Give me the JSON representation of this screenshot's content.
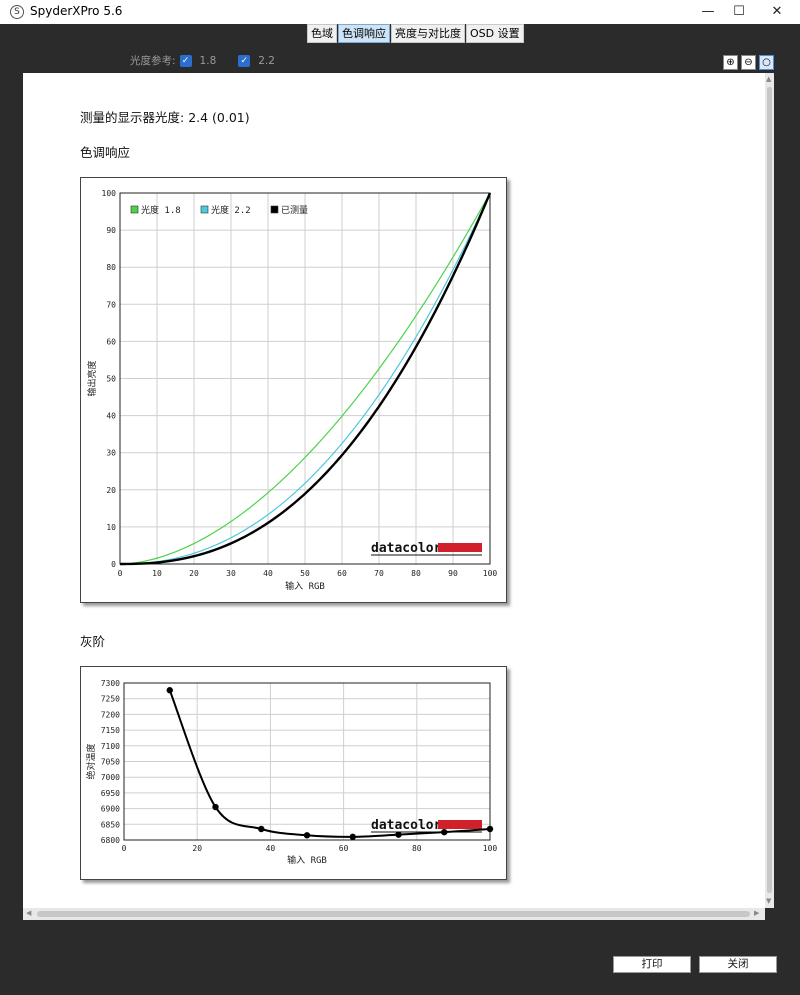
{
  "window": {
    "title": "SpyderXPro 5.6",
    "app_icon_glyph": "S",
    "controls": [
      "—",
      "☐",
      "✕"
    ]
  },
  "tabs": [
    {
      "label": "色域",
      "active": false
    },
    {
      "label": "色调响应",
      "active": true
    },
    {
      "label": "亮度与对比度",
      "active": false
    },
    {
      "label": "OSD 设置",
      "active": false
    }
  ],
  "reference": {
    "label": "光度参考:",
    "options": [
      {
        "label": "1.8",
        "checked": true
      },
      {
        "label": "2.2",
        "checked": true
      }
    ]
  },
  "zoom_icons": [
    "zoom-in-icon",
    "zoom-out-icon",
    "zoom-fit-icon"
  ],
  "report": {
    "measured_label": "测量的显示器光度:",
    "measured_value": "2.4 (0.01)",
    "tone_title": "色调响应",
    "gray_title": "灰阶"
  },
  "brand": {
    "name": "datacolor",
    "bar_color": "#d0202a"
  },
  "chart_data": [
    {
      "type": "line",
      "xlabel": "输入 RGB",
      "ylabel": "输出亮度",
      "xlim": [
        0,
        100
      ],
      "ylim": [
        0,
        100
      ],
      "xticks": [
        0,
        10,
        20,
        30,
        40,
        50,
        60,
        70,
        80,
        90,
        100
      ],
      "yticks": [
        0,
        10,
        20,
        30,
        40,
        50,
        60,
        70,
        80,
        90,
        100
      ],
      "grid": true,
      "legend_position": "top-left",
      "series": [
        {
          "name": "光度 1.8",
          "color": "#4cd24c",
          "gamma": 1.8
        },
        {
          "name": "光度 2.2",
          "color": "#4cc8e0",
          "gamma": 2.2
        },
        {
          "name": "已测量",
          "color": "#000000",
          "gamma": 2.4
        }
      ]
    },
    {
      "type": "line",
      "xlabel": "输入 RGB",
      "ylabel": "绝对温度",
      "xlim": [
        0,
        100
      ],
      "ylim": [
        6800,
        7300
      ],
      "xticks": [
        0,
        20,
        40,
        60,
        80,
        100
      ],
      "yticks": [
        6800,
        6850,
        6900,
        6950,
        7000,
        7050,
        7100,
        7150,
        7200,
        7250,
        7300
      ],
      "grid": true,
      "series": [
        {
          "color": "#000000",
          "x": [
            12.5,
            25,
            37.5,
            50,
            62.5,
            75,
            87.5,
            100
          ],
          "y": [
            7277,
            6905,
            6835,
            6815,
            6810,
            6817,
            6825,
            6835
          ]
        }
      ]
    }
  ],
  "footer": {
    "print_label": "打印",
    "close_label": "关闭"
  }
}
